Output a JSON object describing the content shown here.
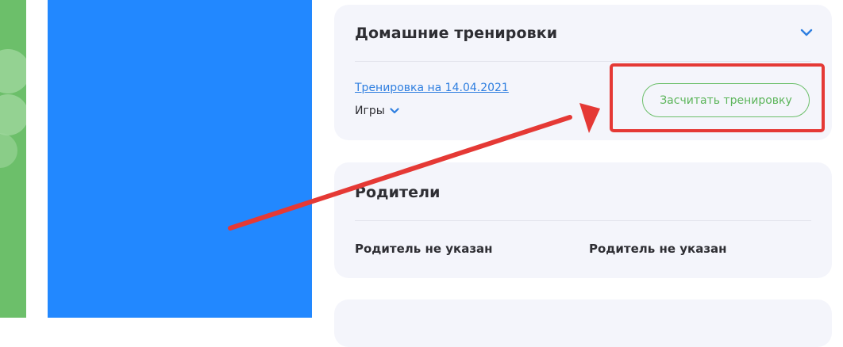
{
  "colors": {
    "green": "#6cbf6a",
    "blue_panel": "#2288ff",
    "card_bg": "#f4f5fb",
    "link": "#2f7fe0",
    "annotation_red": "#e53935"
  },
  "home_training": {
    "title": "Домашние тренировки",
    "training_link": "Тренировка на 14.04.2021",
    "category": "Игры",
    "count_button": "Засчитать тренировку"
  },
  "parents": {
    "title": "Родители",
    "items": [
      "Родитель не указан",
      "Родитель не указан"
    ]
  },
  "icons": {
    "collapse": "chevron-down-icon",
    "category_toggle": "chevron-down-icon",
    "decoration": "clover-icon",
    "annotation": "arrow-icon"
  }
}
